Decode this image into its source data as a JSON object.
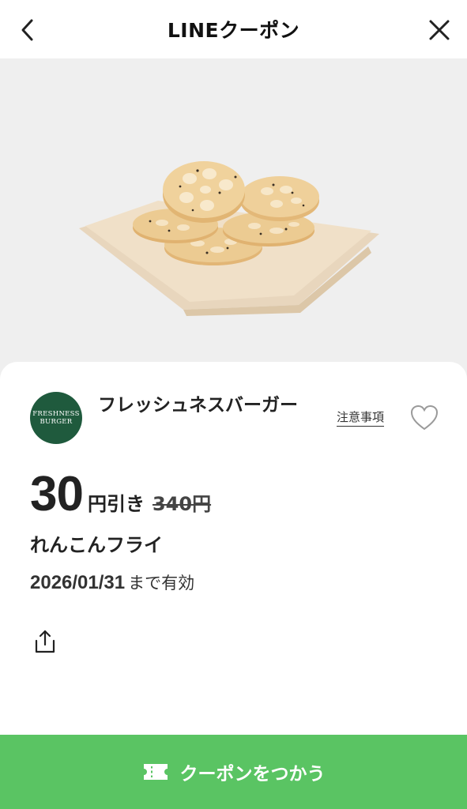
{
  "header": {
    "title": "LINEクーポン",
    "back_icon": "chevron-left-icon",
    "close_icon": "close-icon"
  },
  "hero": {
    "image": "fried-lotus-root-photo"
  },
  "coupon": {
    "brand_logo_lines": [
      "FRESHNESS",
      "BURGER"
    ],
    "brand_name": "フレッシュネスバーガー",
    "notes_link": "注意事項",
    "favorite_icon": "heart-icon",
    "discount_amount": "30",
    "discount_unit": "円引き",
    "original_price": "340円",
    "item_name": "れんこんフライ",
    "valid_until": "2026/01/31",
    "valid_suffix": "まで有効",
    "share_icon": "share-icon"
  },
  "cta": {
    "label": "クーポンをつかう",
    "icon": "ticket-icon"
  },
  "colors": {
    "cta_green": "#5ac463",
    "brand_green": "#1f5a3d",
    "hero_bg": "#efefef"
  }
}
